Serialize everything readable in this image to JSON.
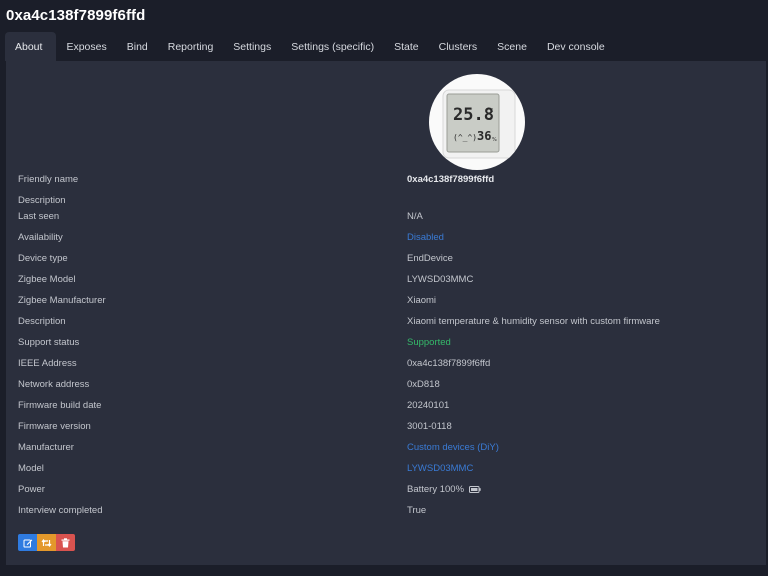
{
  "header": {
    "title": "0xa4c138f7899f6ffd"
  },
  "tabs": [
    {
      "label": "About",
      "active": true
    },
    {
      "label": "Exposes"
    },
    {
      "label": "Bind"
    },
    {
      "label": "Reporting"
    },
    {
      "label": "Settings"
    },
    {
      "label": "Settings (specific)"
    },
    {
      "label": "State"
    },
    {
      "label": "Clusters"
    },
    {
      "label": "Scene"
    },
    {
      "label": "Dev console"
    }
  ],
  "device_image": {
    "temperature": "25.8",
    "temp_unit": "°c",
    "humidity": "36",
    "humidity_unit": "%",
    "face": "(^_^)"
  },
  "rows": [
    {
      "label": "Friendly name",
      "value": "0xa4c138f7899f6ffd"
    },
    {
      "label": "Description",
      "value": ""
    },
    {
      "label": "Last seen",
      "value": "N/A"
    },
    {
      "label": "Availability",
      "value": "Disabled"
    },
    {
      "label": "Device type",
      "value": "EndDevice"
    },
    {
      "label": "Zigbee Model",
      "value": "LYWSD03MMC"
    },
    {
      "label": "Zigbee Manufacturer",
      "value": "Xiaomi"
    },
    {
      "label": "Description",
      "value": "Xiaomi temperature & humidity sensor with custom firmware"
    },
    {
      "label": "Support status",
      "value": "Supported"
    },
    {
      "label": "IEEE Address",
      "value": "0xa4c138f7899f6ffd"
    },
    {
      "label": "Network address",
      "value": "0xD818"
    },
    {
      "label": "Firmware build date",
      "value": "20240101"
    },
    {
      "label": "Firmware version",
      "value": "3001-0118"
    },
    {
      "label": "Manufacturer",
      "value": "Custom devices (DiY)"
    },
    {
      "label": "Model",
      "value": "LYWSD03MMC"
    },
    {
      "label": "Power",
      "value": "Battery 100%"
    },
    {
      "label": "Interview completed",
      "value": "True"
    }
  ],
  "icons": {
    "battery": "battery-full-icon",
    "edit": "edit-icon",
    "reconfigure": "retweet-icon",
    "delete": "trash-icon"
  },
  "colors": {
    "link": "#3a7bd5",
    "success": "#35b96a",
    "edit_button": "#2f7be0",
    "reconfigure_button": "#e3982b",
    "delete_button": "#d9534f"
  }
}
